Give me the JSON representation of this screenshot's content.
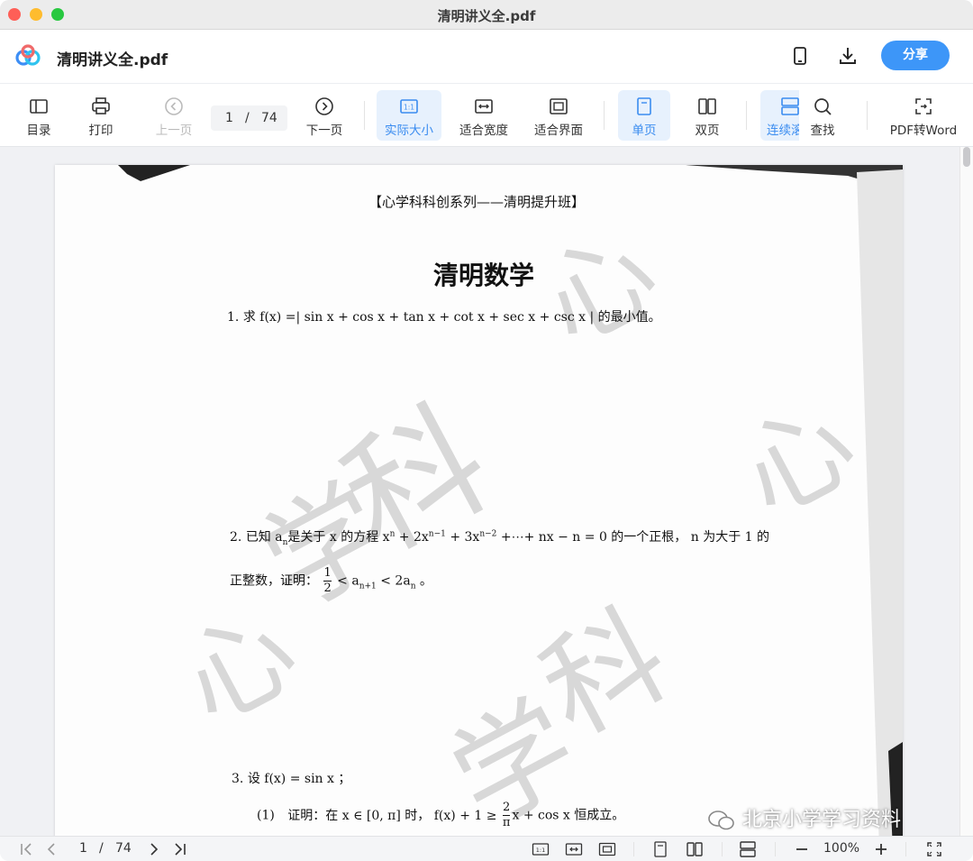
{
  "window": {
    "title": "清明讲义全.pdf"
  },
  "app": {
    "doc_name": "清明讲义全.pdf",
    "share_label": "分享",
    "icons": [
      "phone-icon",
      "download-icon"
    ]
  },
  "toolbar": {
    "toc": "目录",
    "print": "打印",
    "prev_page": "上一页",
    "page_current": "1",
    "page_sep": "/",
    "page_total": "74",
    "next_page": "下一页",
    "actual_size": "实际大小",
    "fit_width": "适合宽度",
    "fit_page": "适合界面",
    "single_page": "单页",
    "double_page": "双页",
    "continuous": "连续滚",
    "find": "查找",
    "pdf_to_word": "PDF转Word",
    "accent_color": "#3d96f8"
  },
  "document": {
    "header": "【心学科科创系列——清明提升班】",
    "title": "清明数学",
    "q1_num": "1.",
    "q1_text": "求 f(x) =| sin x + cos x + tan x + cot x + sec x + csc x | 的最小值。",
    "q2_num": "2.",
    "q2_line1": "已知 a",
    "q2_sub_n": "n",
    "q2_line1_rest": "是关于 x 的方程 x",
    "q2_sup_n": "n",
    "q2_mid": " + 2x",
    "q2_sup_n1": "n−1",
    "q2_mid2": " + 3x",
    "q2_sup_n2": "n−2",
    "q2_tail": " +⋯+ nx − n = 0 的一个正根，  n 为大于 1 的",
    "q2_line2_pre": "正整数，证明：",
    "q2_frac_num": "1",
    "q2_frac_den": "2",
    "q2_line2_mid": " < a",
    "q2_sub_n_plus": "n+1",
    "q2_line2_end": " < 2a",
    "q2_sub_n_end": "n",
    "q2_period": " 。",
    "q3_num": "3.",
    "q3_text": "设 f(x) = sin x ；",
    "q3_1_num": "(1)",
    "q3_1_pre": "证明：在 x ∈ [0, π] 时，  f(x) + 1 ≥",
    "q3_1_frac_num": "2",
    "q3_1_frac_den": "π",
    "q3_1_post": "x + cos x 恒成立。",
    "watermark_chars": [
      "心",
      "学",
      "科",
      "心",
      "学",
      "科",
      "心"
    ],
    "wechat_watermark": "北京小学学习资料"
  },
  "statusbar": {
    "page_current": "1",
    "page_sep": "/",
    "page_total": "74",
    "zoom": "100%"
  }
}
